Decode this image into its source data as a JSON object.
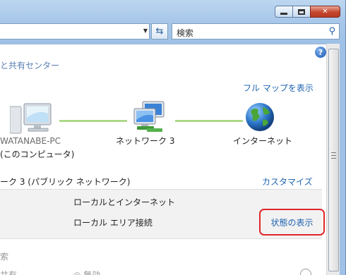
{
  "window": {
    "min_label": "minimize",
    "max_label": "maximize",
    "close_label": "✕"
  },
  "toolbar": {
    "search_placeholder": "検索"
  },
  "breadcrumb": "と共有センター",
  "help_label": "?",
  "map": {
    "full_map_link": "フル マップを表示",
    "computer_name": "WATANABE-PC",
    "computer_sub": "(このコンピュータ)",
    "network_name": "ネットワーク  3",
    "internet_name": "インターネット"
  },
  "network_section": {
    "title": "ーク  3 (パブリック ネットワーク)",
    "customize_link": "カスタマイズ",
    "access_type": "ローカルとインターネット",
    "connection_name": "ローカル エリア接続",
    "status_link": "状態の表示"
  },
  "below": {
    "heading": "索",
    "row_left": "共有",
    "row_mid": "◎ 無効"
  },
  "colors": {
    "link": "#1e63b0",
    "highlight_border": "#e0262a",
    "connection_line": "#8fcc63"
  }
}
